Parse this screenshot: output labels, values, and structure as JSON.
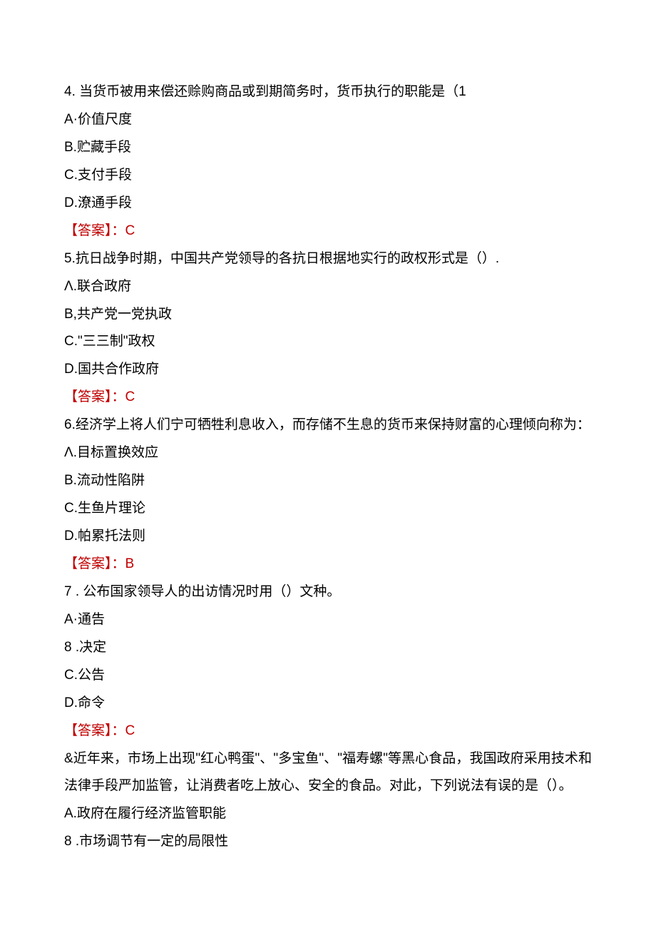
{
  "questions": [
    {
      "number": "4.",
      "text": " 当货币被用来偿还赊购商品或到期简务时，货币执行的职能是（1",
      "options": [
        {
          "label": "A·",
          "text": "价值尺度"
        },
        {
          "label": "B.",
          "text": "贮藏手段"
        },
        {
          "label": "C.",
          "text": "支付手段"
        },
        {
          "label": "D.",
          "text": "潦通手段"
        }
      ],
      "answer_label": "【答案】：",
      "answer_value": "C"
    },
    {
      "number": "5.",
      "text": "抗日战争时期，中国共产党领导的各抗日根据地实行的政权形式是（）.",
      "options": [
        {
          "label": "Λ.",
          "text": "联合政府"
        },
        {
          "label": "B,",
          "text": "共产党一党执政"
        },
        {
          "label": "C.",
          "text": "\"三三制\"政权"
        },
        {
          "label": "D.",
          "text": "国共合作政府"
        }
      ],
      "answer_label": "【答案】：",
      "answer_value": "C"
    },
    {
      "number": "6.",
      "text": "经济学上将人们宁可牺牲利息收入，而存储不生息的货币来保持财富的心理倾向称为：",
      "options": [
        {
          "label": "Λ.",
          "text": "目标置换效应"
        },
        {
          "label": "B.",
          "text": "流动性陷阱"
        },
        {
          "label": "C.",
          "text": "生鱼片理论"
        },
        {
          "label": "D.",
          "text": "帕累托法则"
        }
      ],
      "answer_label": "【答案】：",
      "answer_value": "B"
    },
    {
      "number": "7",
      "text": " . 公布国家领导人的出访情况时用（）文种。",
      "options": [
        {
          "label": "A·",
          "text": "通告"
        },
        {
          "label": "8",
          "text": " .决定"
        },
        {
          "label": "C.",
          "text": "公告"
        },
        {
          "label": "D.",
          "text": "命令"
        }
      ],
      "answer_label": "【答案】：",
      "answer_value": "C"
    },
    {
      "number": "&",
      "text": "近年来，市场上出现\"红心鸭蛋\"、\"多宝鱼\"、\"福寿螺\"等黑心食品，我国政府采用技术和法律手段严加监管，让消费者吃上放心、安全的食品。对此，下列说法有误的是（）。",
      "options": [
        {
          "label": "A.",
          "text": "政府在履行经济监管职能"
        },
        {
          "label": "8",
          "text": " .市场调节有一定的局限性"
        }
      ],
      "answer_label": "",
      "answer_value": ""
    }
  ]
}
